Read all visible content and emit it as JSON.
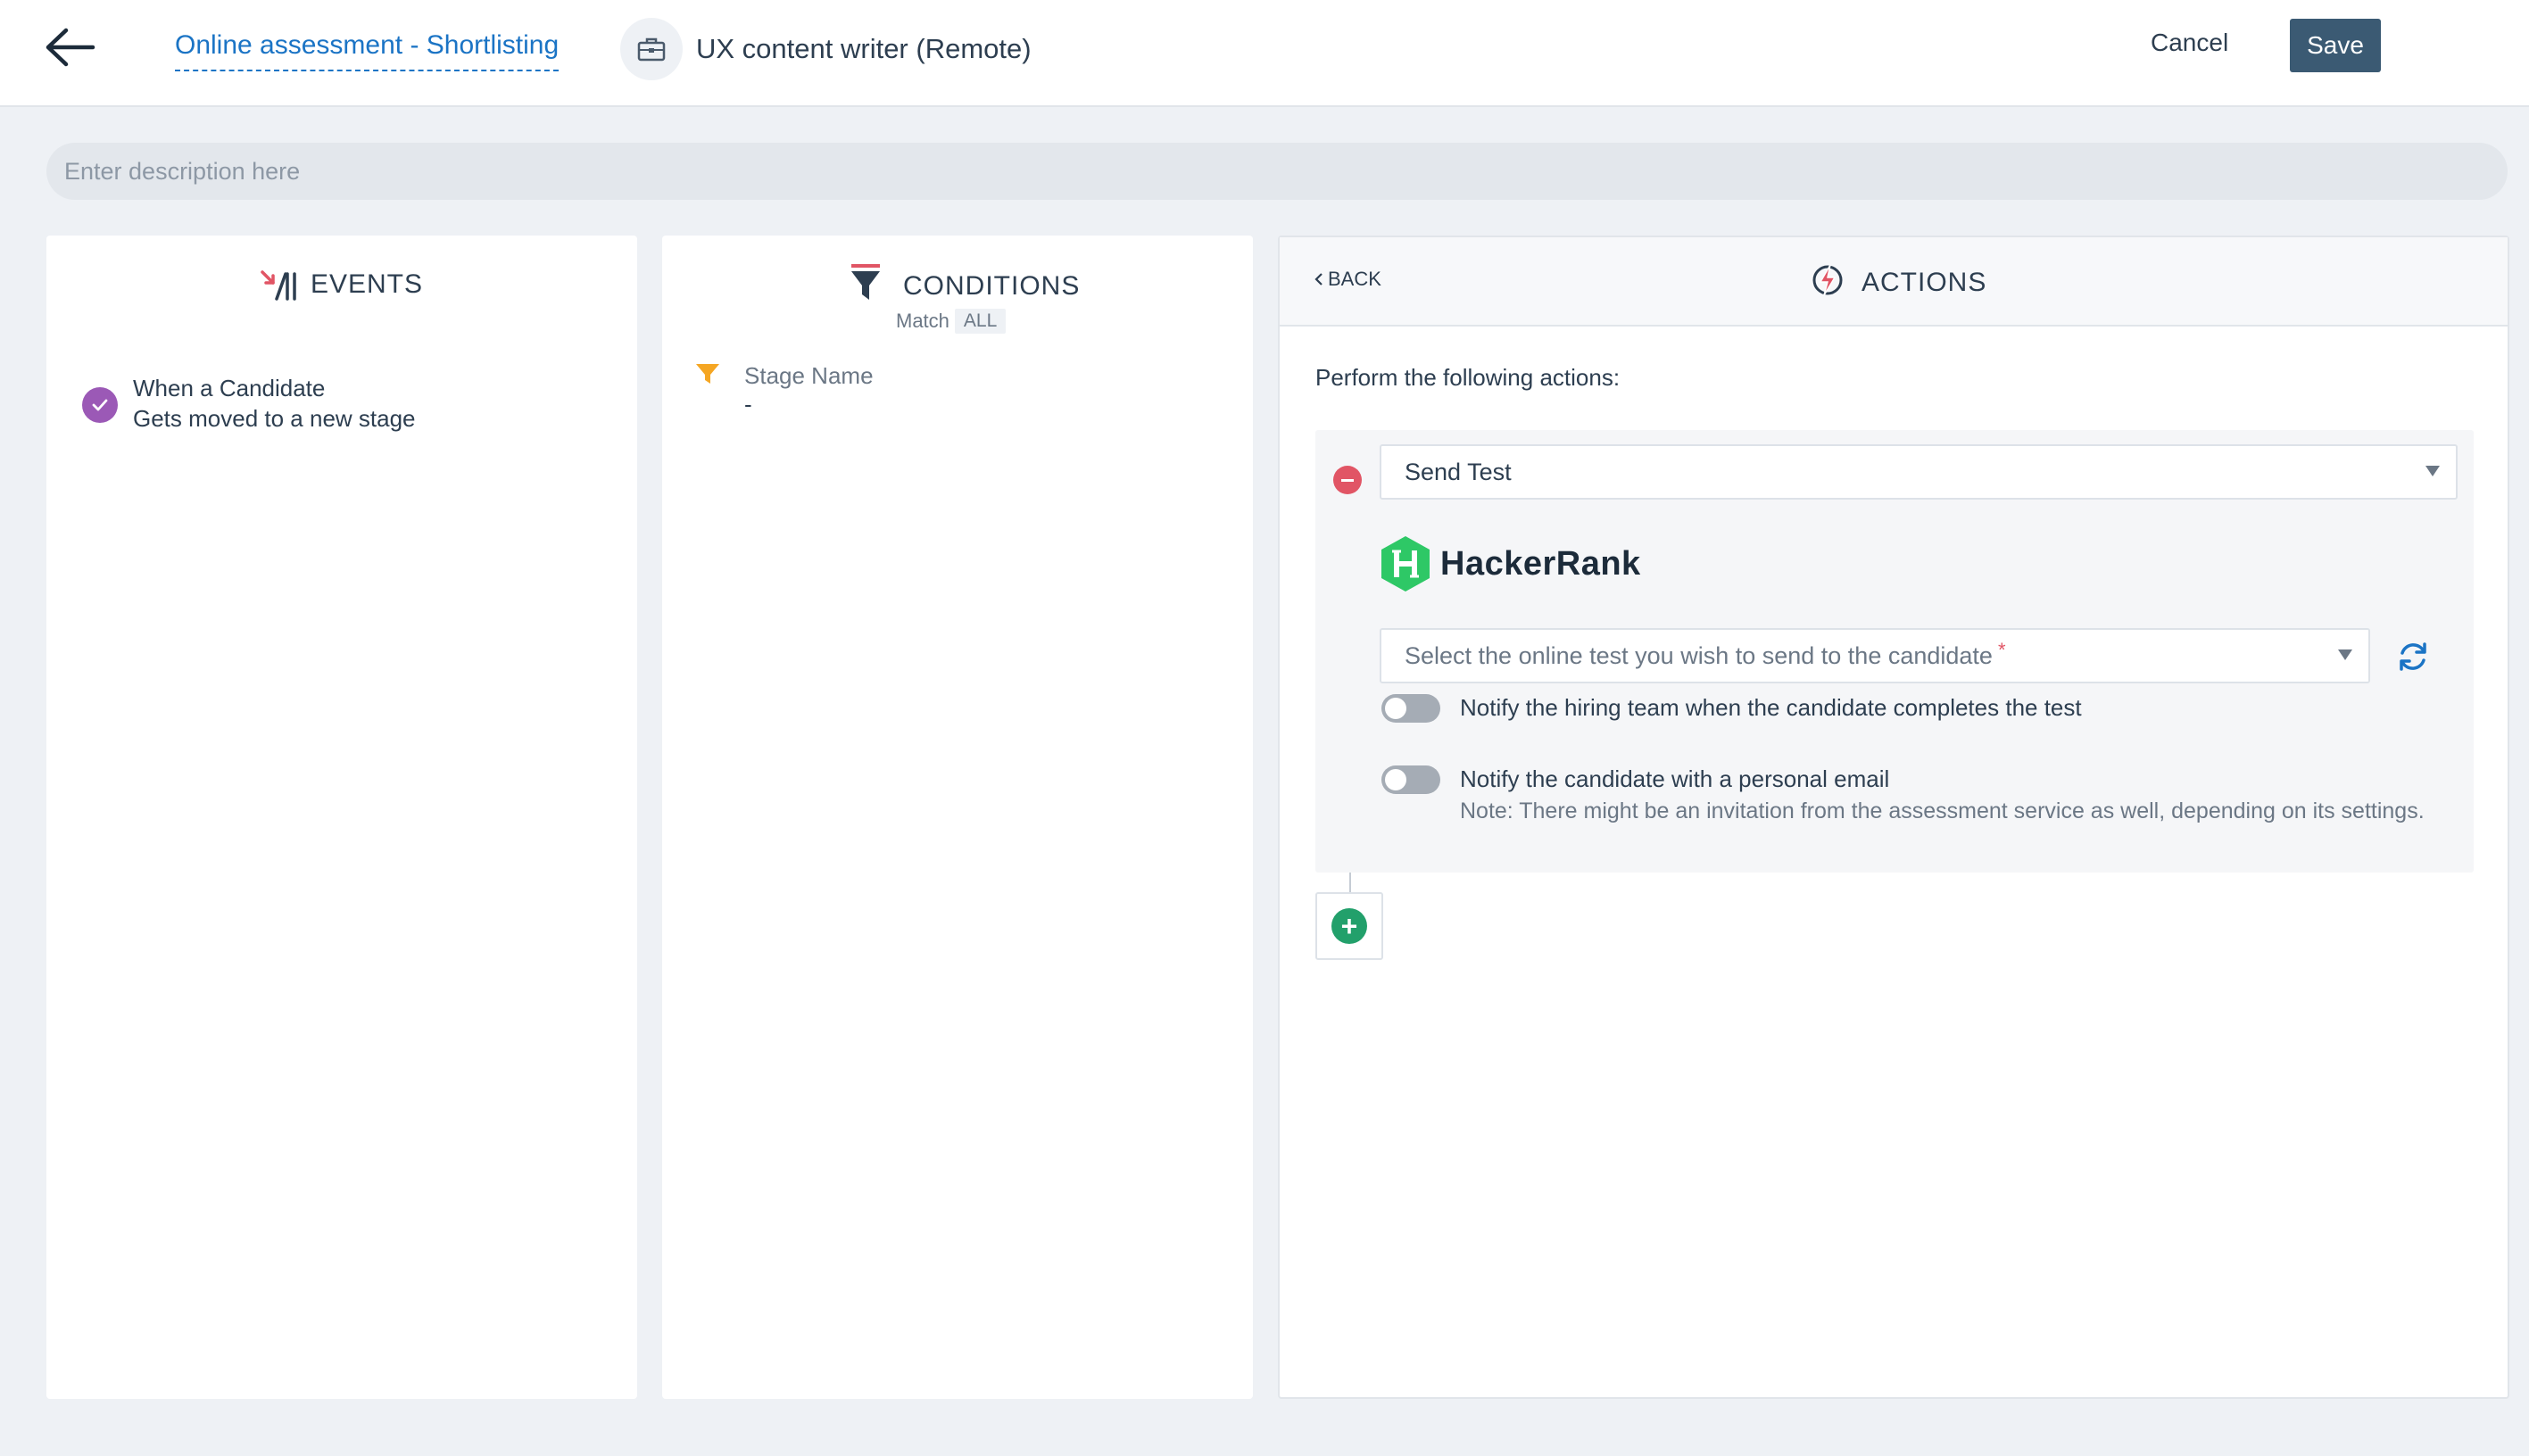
{
  "header": {
    "title": "Online assessment - Shortlisting",
    "job_title": "UX content writer (Remote)",
    "cancel_label": "Cancel",
    "save_label": "Save"
  },
  "description": {
    "placeholder": "Enter description here"
  },
  "events": {
    "title": "EVENTS",
    "item_line1": "When a Candidate",
    "item_line2": "Gets moved to a new stage"
  },
  "conditions": {
    "title": "CONDITIONS",
    "match_label": "Match",
    "match_value": "ALL",
    "label": "Stage Name",
    "value": "-"
  },
  "actions": {
    "back_label": "BACK",
    "title": "ACTIONS",
    "intro": "Perform the following actions:",
    "action_type": "Send Test",
    "provider": "HackerRank",
    "test_placeholder": "Select the online test you wish to send to the candidate",
    "required_mark": "*",
    "toggle1_label": "Notify the hiring team when the candidate completes the test",
    "toggle1_on": false,
    "toggle2_label": "Notify the candidate with a personal email",
    "toggle2_on": false,
    "note": "Note: There might be an invitation from the assessment service as well, depending on its settings."
  },
  "colors": {
    "primary_link": "#1b74c5",
    "save_button": "#3b5a73",
    "event_check": "#9b59b6",
    "remove": "#e15565",
    "add": "#22a06b",
    "hackerrank": "#2ec866",
    "funnel": "#f5a623"
  }
}
